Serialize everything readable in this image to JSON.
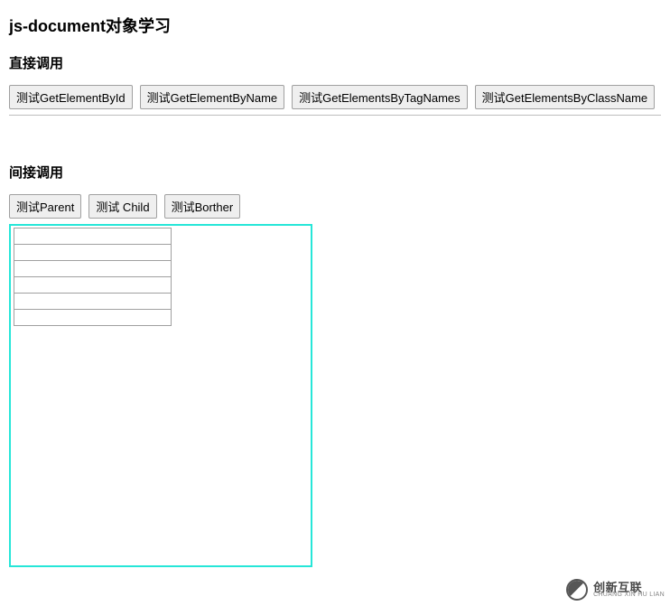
{
  "title": "js-document对象学习",
  "section1": {
    "heading": "直接调用",
    "buttons": [
      "测试GetElementById",
      "测试GetElementByName",
      "测试GetElementsByTagNames",
      "测试GetElementsByClassName"
    ]
  },
  "section2": {
    "heading": "间接调用",
    "buttons": [
      "测试Parent",
      "测试 Child",
      "测试Borther"
    ]
  },
  "table": {
    "rows": 6,
    "cols": 1
  },
  "container": {
    "border_color": "#26e6d8"
  },
  "watermark": {
    "brand": "创新互联",
    "sub": "CHUANG XIN HU LIAN"
  }
}
